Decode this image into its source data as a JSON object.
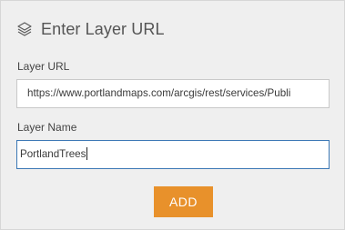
{
  "header": {
    "icon": "layers-icon",
    "title": "Enter Layer URL"
  },
  "form": {
    "url_label": "Layer URL",
    "url_value": "https://www.portlandmaps.com/arcgis/rest/services/Publi",
    "name_label": "Layer Name",
    "name_value": "PortlandTrees"
  },
  "actions": {
    "add_label": "ADD"
  },
  "colors": {
    "panel_background": "#efefef",
    "accent_button": "#e8912b",
    "focused_border": "#3c78b5"
  }
}
